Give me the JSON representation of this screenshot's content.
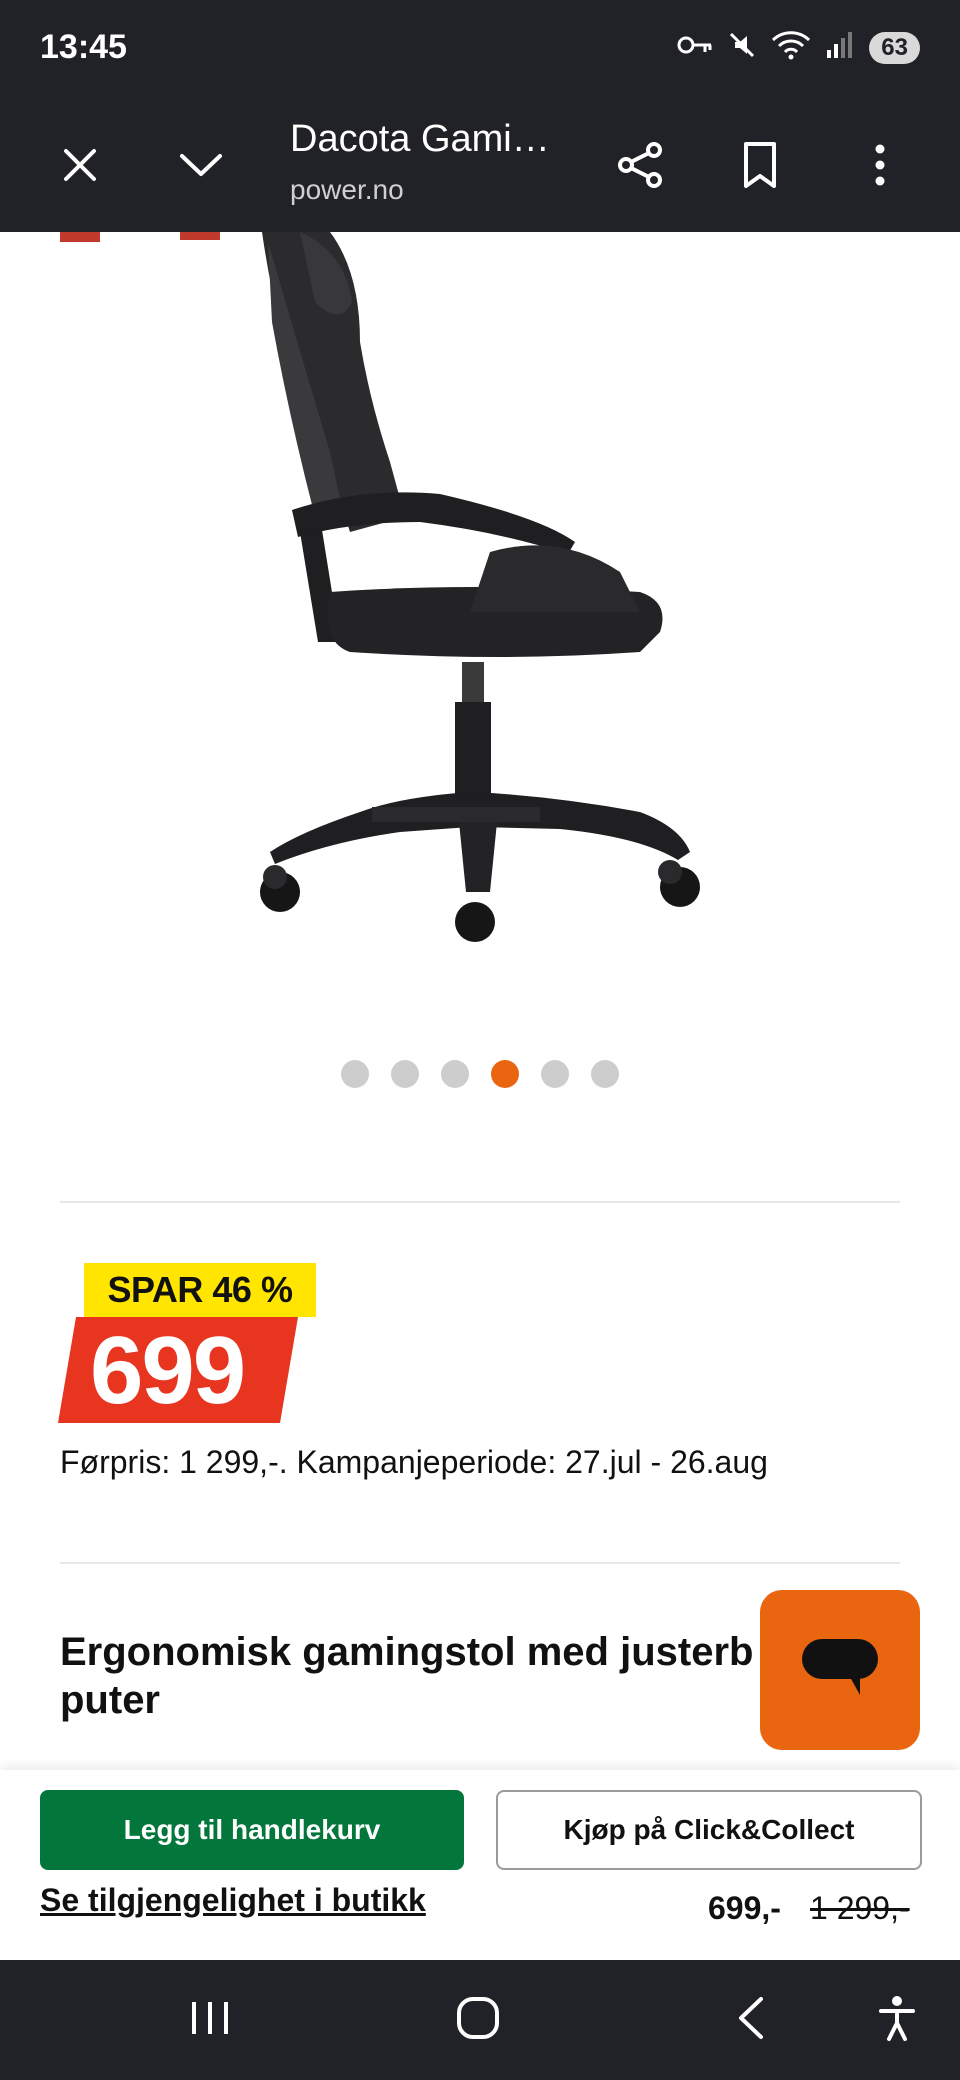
{
  "status_bar": {
    "time": "13:45",
    "battery": "63"
  },
  "toolbar": {
    "title": "Dacota Gami…",
    "url": "power.no"
  },
  "carousel": {
    "count": 6,
    "active_index": 3
  },
  "offer": {
    "badge": "SPAR 46 %",
    "price": "699",
    "previous_price_text": "Førpris: 1 299,-. Kampanjeperiode: 27.jul - 26.aug"
  },
  "product": {
    "headline": "Ergonomisk gamingstol med justerb puter"
  },
  "bottom_bar": {
    "add_to_cart": "Legg til handlekurv",
    "click_collect": "Kjøp på Click&Collect",
    "availability": "Se tilgjengelighet i butikk",
    "price": "699,-",
    "old_price": "1 299,-"
  },
  "colors": {
    "accent": "#e9650f",
    "cart_green": "#03773b",
    "badge_yellow": "#ffe500",
    "price_red": "#e8351f",
    "chrome": "#212227"
  },
  "icons": [
    "close-icon",
    "chevron-down-icon",
    "share-icon",
    "bookmark-icon",
    "more-vert-icon",
    "chat-icon",
    "recents-icon",
    "home-icon",
    "back-icon",
    "accessibility-icon"
  ]
}
